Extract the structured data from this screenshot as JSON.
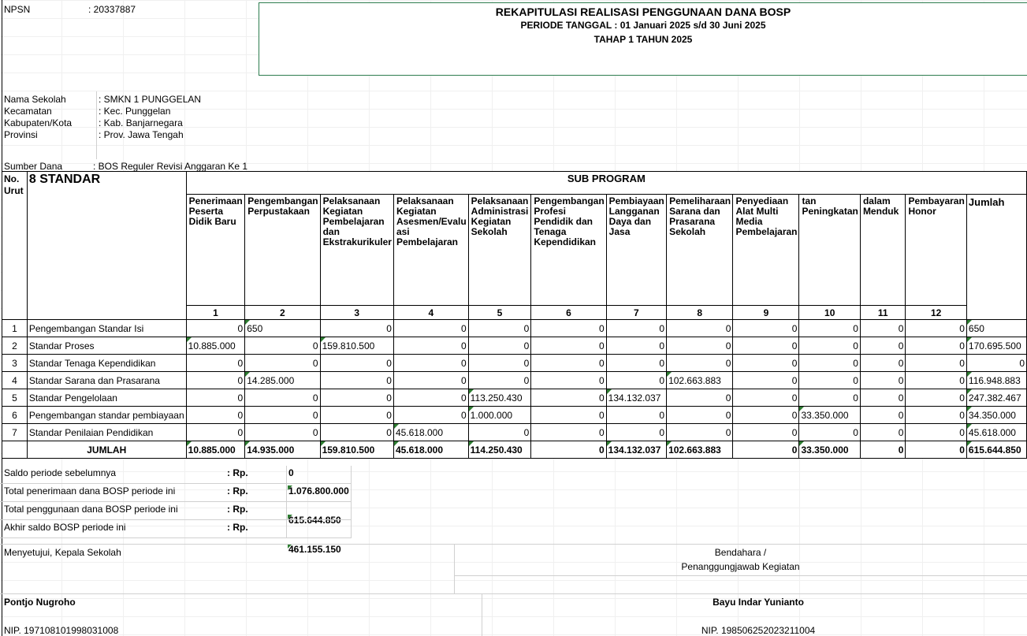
{
  "header": {
    "npsn_label": "NPSN",
    "npsn_value": ": 20337887",
    "title": "REKAPITULASI REALISASI PENGGUNAAN DANA BOSP",
    "period": "PERIODE TANGGAL : 01 Januari 2025 s/d 30 Juni 2025",
    "stage": "TAHAP 1 TAHUN 2025"
  },
  "school": {
    "rows": [
      {
        "label": "Nama Sekolah",
        "value": ": SMKN 1 PUNGGELAN"
      },
      {
        "label": "Kecamatan",
        "value": ": Kec. Punggelan"
      },
      {
        "label": "Kabupaten/Kota",
        "value": ": Kab. Banjarnegara"
      },
      {
        "label": "Provinsi",
        "value": ": Prov. Jawa Tengah"
      }
    ],
    "fund_label": "Sumber Dana",
    "fund_value": ": BOS Reguler Revisi Anggaran Ke 1"
  },
  "table": {
    "no_header": "No. Urut",
    "standard_header": "8 STANDAR",
    "subprogram_header": "SUB PROGRAM",
    "total_header": "Jumlah",
    "columns": [
      {
        "label": "Penerimaan Peserta Didik Baru",
        "num": "1"
      },
      {
        "label": "Pengembangan Perpustakaan",
        "num": "2"
      },
      {
        "label": "Pelaksanaan Kegiatan Pembelajaran dan Ekstrakurikuler",
        "num": "3"
      },
      {
        "label": "Pelaksanaan Kegiatan Asesmen/Evalu asi Pembelajaran",
        "num": "4"
      },
      {
        "label": "Pelaksanaan Administrasi Kegiatan Sekolah",
        "num": "5"
      },
      {
        "label": "Pengembangan Profesi Pendidik dan Tenaga Kependidikan",
        "num": "6"
      },
      {
        "label": "Pembiayaan Langganan Daya dan Jasa",
        "num": "7"
      },
      {
        "label": "Pemeliharaan Sarana dan Prasarana Sekolah",
        "num": "8"
      },
      {
        "label": "Penyediaan Alat Multi Media Pembelajaran",
        "num": "9"
      },
      {
        "label": "tan Peningkatan",
        "num": "10"
      },
      {
        "label": "dalam Menduk",
        "num": "11"
      },
      {
        "label": "Pembayaran Honor",
        "num": "12"
      }
    ],
    "rows": [
      {
        "no": "1",
        "name": "Pengembangan Standar Isi",
        "cells": [
          "0",
          "650",
          "0",
          "0",
          "0",
          "0",
          "0",
          "0",
          "0",
          "0",
          "0",
          "0"
        ],
        "total": "650"
      },
      {
        "no": "2",
        "name": "Standar Proses",
        "cells": [
          "10.885.000",
          "0",
          "159.810.500",
          "0",
          "0",
          "0",
          "0",
          "0",
          "0",
          "0",
          "0",
          "0"
        ],
        "total": "170.695.500"
      },
      {
        "no": "3",
        "name": "Standar Tenaga Kependidikan",
        "cells": [
          "0",
          "0",
          "0",
          "0",
          "0",
          "0",
          "0",
          "0",
          "0",
          "0",
          "0",
          "0"
        ],
        "total": "0"
      },
      {
        "no": "4",
        "name": "Standar Sarana dan Prasarana",
        "cells": [
          "0",
          "14.285.000",
          "0",
          "0",
          "0",
          "0",
          "0",
          "102.663.883",
          "0",
          "0",
          "0",
          "0"
        ],
        "total": "116.948.883"
      },
      {
        "no": "5",
        "name": "Standar Pengelolaan",
        "cells": [
          "0",
          "0",
          "0",
          "0",
          "113.250.430",
          "0",
          "134.132.037",
          "0",
          "0",
          "0",
          "0",
          "0"
        ],
        "total": "247.382.467"
      },
      {
        "no": "6",
        "name": "Pengembangan standar pembiayaan",
        "cells": [
          "0",
          "0",
          "0",
          "0",
          "1.000.000",
          "0",
          "0",
          "0",
          "0",
          "33.350.000",
          "0",
          "0"
        ],
        "total": "34.350.000"
      },
      {
        "no": "7",
        "name": "Standar Penilaian Pendidikan",
        "cells": [
          "0",
          "0",
          "0",
          "45.618.000",
          "0",
          "0",
          "0",
          "0",
          "0",
          "0",
          "0",
          "0"
        ],
        "total": "45.618.000"
      }
    ],
    "totals_label": "JUMLAH",
    "totals": [
      "10.885.000",
      "14.935.000",
      "159.810.500",
      "45.618.000",
      "114.250.430",
      "0",
      "134.132.037",
      "102.663.883",
      "0",
      "33.350.000",
      "0",
      "0"
    ],
    "grand_total": "615.644.850"
  },
  "summary": {
    "rows": [
      {
        "label": "Saldo periode sebelumnya",
        "rp": ": Rp.",
        "value": "0"
      },
      {
        "label": "Total penerimaan dana BOSP periode ini",
        "rp": ": Rp.",
        "value": "1.076.800.000"
      },
      {
        "label": "Total penggunaan dana BOSP periode ini",
        "rp": ": Rp.",
        "value": "615.644.850"
      },
      {
        "label": "Akhir saldo BOSP periode ini",
        "rp": ": Rp.",
        "value": "461.155.150"
      }
    ]
  },
  "signatures": {
    "left_title": "Menyetujui, Kepala Sekolah",
    "right_title_1": "Bendahara /",
    "right_title_2": "Penanggungjawab Kegiatan",
    "left_name": "Pontjo Nugroho",
    "right_name": "Bayu Indar Yunianto",
    "left_nip": "NIP. 197108101998031008",
    "right_nip": "NIP. 198506252023211004"
  }
}
